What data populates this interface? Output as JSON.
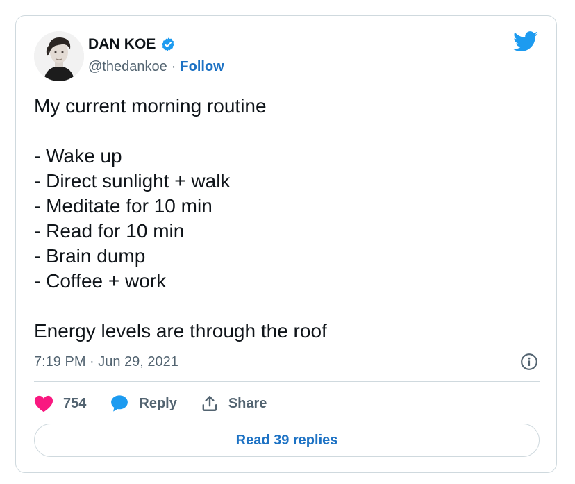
{
  "author": {
    "name": "DAN KOE",
    "handle": "@thedankoe",
    "separator": "·",
    "follow_label": "Follow",
    "verified": true
  },
  "tweet": {
    "lines": [
      "My current morning routine",
      "",
      "- Wake up",
      "- Direct sunlight + walk",
      "- Meditate for 10 min",
      "- Read for 10 min",
      "- Brain dump",
      "- Coffee + work",
      "",
      "Energy levels are through the roof"
    ],
    "timestamp": "7:19 PM · Jun 29, 2021"
  },
  "actions": {
    "likes_count": "754",
    "reply_label": "Reply",
    "share_label": "Share"
  },
  "read_replies_label": "Read 39 replies",
  "icons": {
    "brand": "twitter-bird-icon",
    "verified": "verified-badge-icon",
    "info": "info-icon",
    "like": "heart-icon",
    "reply": "speech-bubble-icon",
    "share": "share-icon"
  },
  "colors": {
    "accent_blue": "#1d9bf0",
    "link_blue": "#1d72c4",
    "like_pink": "#f91880",
    "text_primary": "#0f1419",
    "text_secondary": "#536471",
    "border": "#cfd9de"
  }
}
